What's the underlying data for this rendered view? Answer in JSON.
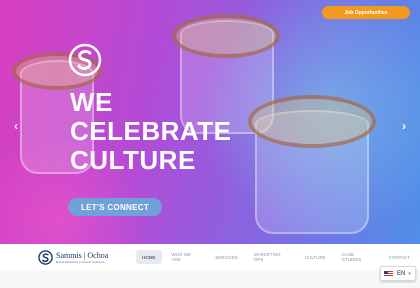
{
  "top_button": {
    "label": "Job Opportunities"
  },
  "hero": {
    "headline_lines": [
      "WE",
      "CELEBRATE",
      "CULTURE"
    ],
    "cta_label": "LET'S CONNECT",
    "prev_icon": "chevron-left-icon",
    "next_icon": "chevron-right-icon",
    "gradient_colors": [
      "#d93fbf",
      "#8a63e0",
      "#4f8fe8"
    ]
  },
  "brand": {
    "name": "Sammis | Ochoa",
    "tagline": "Brand Marketing & Growth Solutions"
  },
  "nav": {
    "items": [
      {
        "label": "HOME",
        "active": true
      },
      {
        "label": "WHO WE ARE",
        "active": false
      },
      {
        "label": "SERVICES",
        "active": false
      },
      {
        "label": "MARKETING OPS",
        "active": false
      },
      {
        "label": "CULTURE",
        "active": false
      },
      {
        "label": "CASE STUDIES",
        "active": false
      },
      {
        "label": "CONTACT",
        "active": false
      }
    ]
  },
  "language": {
    "code": "EN",
    "icon": "us-flag-icon"
  },
  "colors": {
    "accent": "#f29a1e",
    "cta": "#6fa0d8",
    "brand": "#1e3a6a"
  }
}
